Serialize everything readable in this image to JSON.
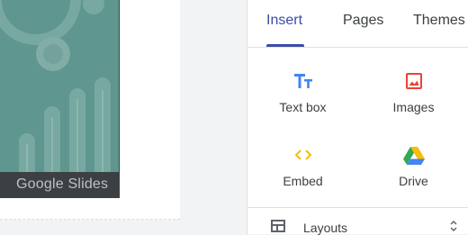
{
  "canvas": {
    "logo_text": "Google Slides"
  },
  "panel": {
    "tabs": [
      {
        "label": "Insert",
        "active": true
      },
      {
        "label": "Pages",
        "active": false
      },
      {
        "label": "Themes",
        "active": false
      }
    ],
    "tools": [
      {
        "label": "Text box",
        "icon": "text-box-icon",
        "color": "#4285f4"
      },
      {
        "label": "Images",
        "icon": "images-icon",
        "color": "#ea4335"
      },
      {
        "label": "Embed",
        "icon": "embed-icon",
        "color": "#fbbc04"
      },
      {
        "label": "Drive",
        "icon": "drive-icon",
        "color": "#34a853"
      }
    ],
    "sections": [
      {
        "label": "Layouts",
        "icon": "layouts-icon",
        "expanded": true
      }
    ]
  },
  "colors": {
    "accent": "#3c4ca8",
    "slide_bg": "#5f968f"
  }
}
